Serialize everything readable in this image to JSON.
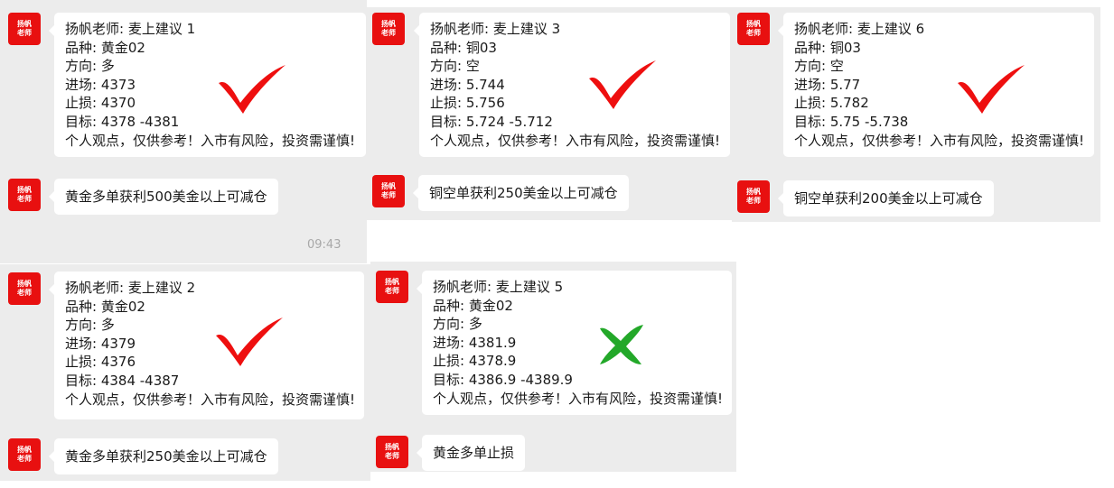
{
  "avatar": {
    "line1": "扬帆",
    "line2": "老师",
    "color": "#e81010"
  },
  "check_color": "#ee0f0f",
  "cross_color": "#23a829",
  "timestamp": "09:43",
  "cards": [
    {
      "lines": [
        "扬帆老师:  麦上建议 1",
        "品种:  黄金02",
        "方向:  多",
        "进场:  4373",
        "止损:  4370",
        "目标:  4378 -4381",
        "个人观点，仅供参考！入市有风险，投资需谨慎!"
      ],
      "result": "check-icon"
    },
    {
      "lines": [
        "扬帆老师:  麦上建议 3",
        "品种:  铜03",
        "方向:  空",
        "进场:  5.744",
        "止损:  5.756",
        "目标:  5.724 -5.712",
        "个人观点，仅供参考！入市有风险，投资需谨慎!"
      ],
      "result": "check-icon"
    },
    {
      "lines": [
        "扬帆老师:  麦上建议 6",
        "品种:  铜03",
        "方向:  空",
        "进场:  5.77",
        "止损:  5.782",
        "目标:  5.75 -5.738",
        "个人观点，仅供参考！入市有风险，投资需谨慎!"
      ],
      "result": "check-icon"
    },
    {
      "lines": [
        "扬帆老师:  麦上建议 2",
        "品种:  黄金02",
        "方向:  多",
        "进场:  4379",
        "止损:  4376",
        "目标:  4384 -4387",
        "个人观点，仅供参考！入市有风险，投资需谨慎!"
      ],
      "result": "check-icon"
    },
    {
      "lines": [
        "扬帆老师:  麦上建议 5",
        "品种:  黄金02",
        "方向:  多",
        "进场:  4381.9",
        "止损:  4378.9",
        "目标:  4386.9 -4389.9",
        "个人观点，仅供参考！入市有风险，投资需谨慎!"
      ],
      "result": "cross-icon"
    }
  ],
  "replies": [
    "黄金多单获利500美金以上可减仓",
    "铜空单获利250美金以上可减仓",
    "铜空单获利200美金以上可减仓",
    "黄金多单获利250美金以上可减仓",
    "黄金多单止损"
  ]
}
